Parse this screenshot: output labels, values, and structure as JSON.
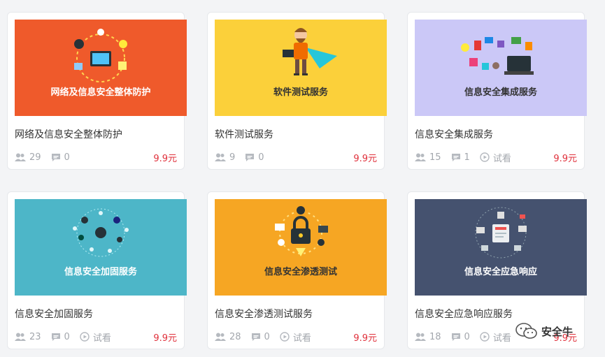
{
  "cards": [
    {
      "banner_text": "网络及信息安全整体防护",
      "title": "网络及信息安全整体防护",
      "students": "29",
      "comments": "0",
      "trial": "",
      "price": "9.9元",
      "bg": "#ef5a2b",
      "banner_color": "#ffffff"
    },
    {
      "banner_text": "软件测试服务",
      "title": "软件测试服务",
      "students": "9",
      "comments": "0",
      "trial": "",
      "price": "9.9元",
      "bg": "#fbd03a",
      "banner_color": "#333333"
    },
    {
      "banner_text": "信息安全集成服务",
      "title": "信息安全集成服务",
      "students": "15",
      "comments": "1",
      "trial": "试看",
      "price": "9.9元",
      "bg": "#cbc8f7",
      "banner_color": "#333333"
    },
    {
      "banner_text": "信息安全加固服务",
      "title": "信息安全加固服务",
      "students": "23",
      "comments": "0",
      "trial": "试看",
      "price": "9.9元",
      "bg": "#4db6c8",
      "banner_color": "#ffffff"
    },
    {
      "banner_text": "信息安全渗透测试",
      "title": "信息安全渗透测试服务",
      "students": "28",
      "comments": "0",
      "trial": "试看",
      "price": "9.9元",
      "bg": "#f6a623",
      "banner_color": "#333333"
    },
    {
      "banner_text": "信息安全应急响应",
      "title": "信息安全应急响应服务",
      "students": "18",
      "comments": "0",
      "trial": "试看",
      "price": "9.9元",
      "bg": "#45526f",
      "banner_color": "#ffffff"
    }
  ],
  "watermark": {
    "text": "安全牛",
    "icon": "wechat-icon"
  },
  "colors": {
    "price": "#e0303b",
    "meta": "#a3a7ad",
    "title": "#333333"
  }
}
